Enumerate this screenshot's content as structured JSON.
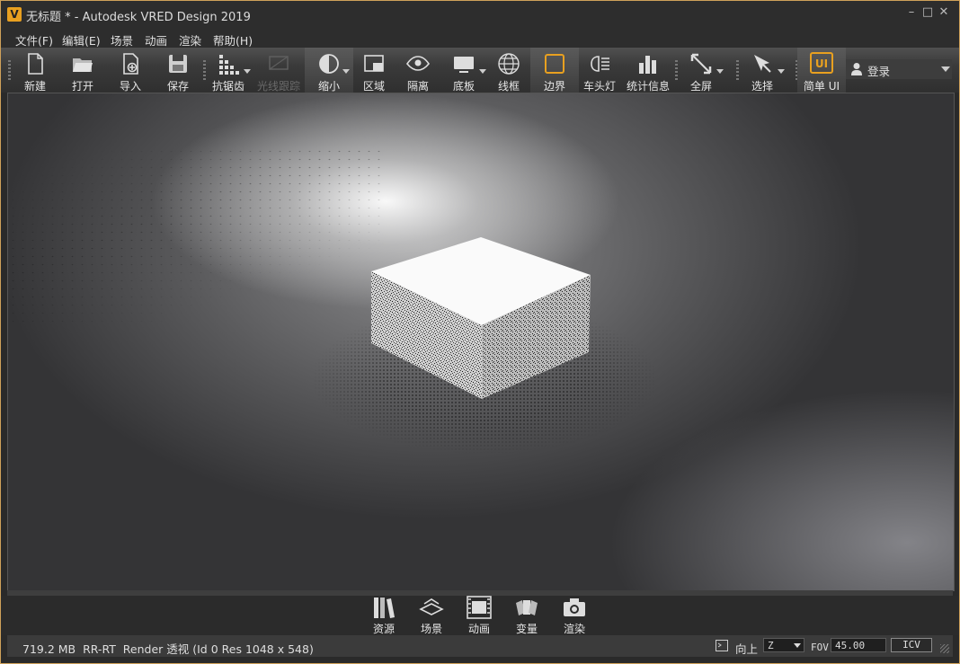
{
  "window": {
    "title": "无标题 * - Autodesk VRED Design 2019",
    "logo_letter": "V",
    "controls": {
      "minimize": "–",
      "maximize": "□",
      "close": "✕"
    }
  },
  "menu": [
    {
      "label": "文件(F)"
    },
    {
      "label": "编辑(E)"
    },
    {
      "label": "场景"
    },
    {
      "label": "动画"
    },
    {
      "label": "渲染"
    },
    {
      "label": "帮助(H)"
    }
  ],
  "toolbar": {
    "new": "新建",
    "open": "打开",
    "import": "导入",
    "save": "保存",
    "antialias": "抗锯齿",
    "raytrace": "光线跟踪",
    "zoom": "缩小",
    "region": "区域",
    "isolate": "隔离",
    "floor": "底板",
    "wireframe": "线框",
    "boundary": "边界",
    "headlight": "车头灯",
    "statistics": "统计信息",
    "fullscreen": "全屏",
    "select": "选择",
    "simple_ui": "简单 UI",
    "simple_ui_icon_text": "UI"
  },
  "login": {
    "label": "登录",
    "icon": "user-icon"
  },
  "dock": {
    "assets": "资源",
    "scene": "场景",
    "animation": "动画",
    "variants": "变量",
    "render": "渲染"
  },
  "status": {
    "info": "719.2 MB  RR-RT  Render 透视 (Id 0 Res 1048 x 548)",
    "up_label": "向上",
    "up_value": "Z",
    "fov_label": "FOV",
    "fov_value": "45.00",
    "icv_button": "ICV"
  },
  "colors": {
    "accent": "#e8a020",
    "frame": "#cfa15a",
    "toolbar": "#3a3a3a"
  }
}
